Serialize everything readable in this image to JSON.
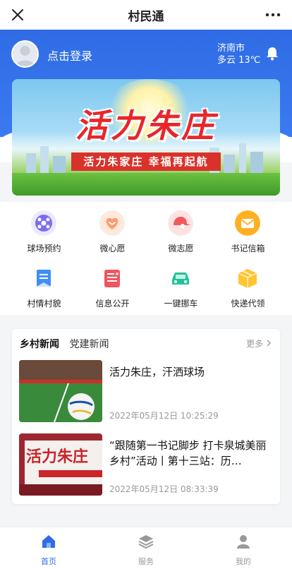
{
  "titlebar": {
    "title": "村民通",
    "close_icon": "close-icon",
    "more_icon": "more-icon"
  },
  "header": {
    "login_label": "点击登录",
    "city": "济南市",
    "weather": "多云 13℃"
  },
  "banner": {
    "brand": "活力朱庄",
    "slogan": "活力朱家庄 幸福再起航"
  },
  "services": [
    {
      "label": "球场预约",
      "icon": "soccer-icon",
      "color": "#7b6cf0"
    },
    {
      "label": "微心愿",
      "icon": "heart-icon",
      "color": "#ff9a6a"
    },
    {
      "label": "微志愿",
      "icon": "cap-icon",
      "color": "#f05a5a"
    },
    {
      "label": "书记信箱",
      "icon": "mail-icon",
      "color": "#ffb020"
    },
    {
      "label": "村情村貌",
      "icon": "bookmark-icon",
      "color": "#3e8ef7"
    },
    {
      "label": "信息公开",
      "icon": "document-icon",
      "color": "#f0555e"
    },
    {
      "label": "一键挪车",
      "icon": "car-icon",
      "color": "#22c39a"
    },
    {
      "label": "快递代领",
      "icon": "package-icon",
      "color": "#ffc533"
    }
  ],
  "news": {
    "tab_active": "乡村新闻",
    "tab_other": "党建新闻",
    "more": "更多",
    "items": [
      {
        "title": "活力朱庄，汗洒球场",
        "time": "2022年05月12日 10:25:29"
      },
      {
        "title": "“跟随第一书记脚步 打卡泉城美丽乡村”活动丨第十三站：历…",
        "time": "2022年05月12日 08:33:39",
        "thumb_text": "活力朱庄"
      }
    ]
  },
  "tabbar": [
    {
      "label": "首页",
      "icon": "home-icon",
      "active": true
    },
    {
      "label": "服务",
      "icon": "layers-icon",
      "active": false
    },
    {
      "label": "我的",
      "icon": "user-icon",
      "active": false
    }
  ],
  "colors": {
    "primary": "#2f6ce5",
    "tab_active": "#2f6ce5",
    "tab_inactive": "#999999"
  }
}
